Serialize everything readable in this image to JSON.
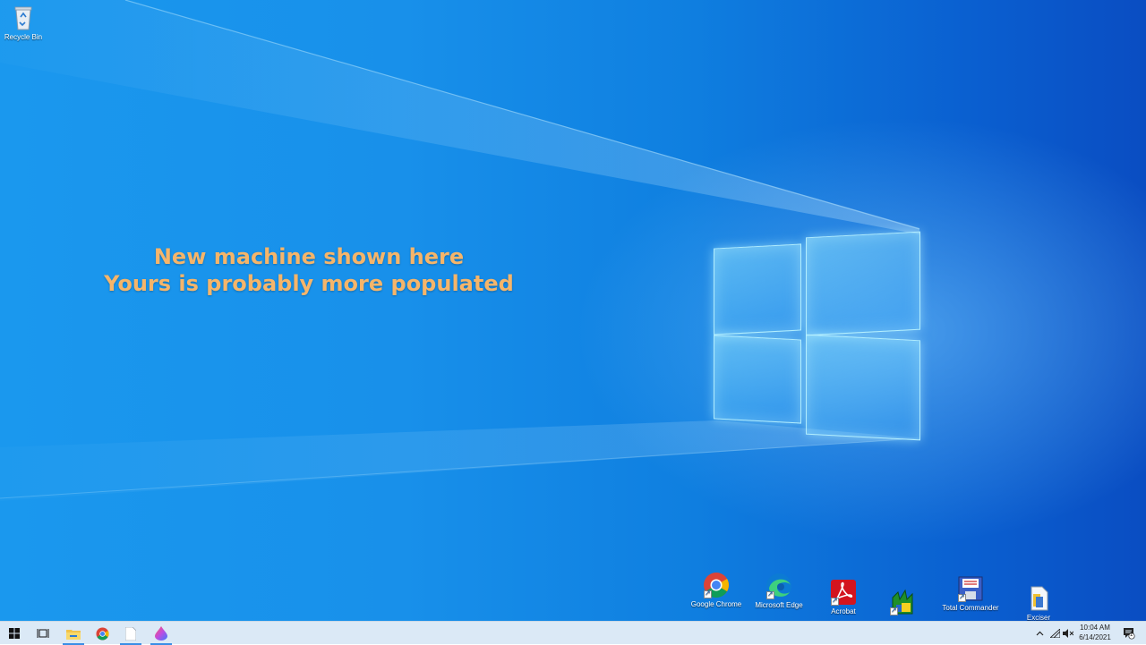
{
  "desktop": {
    "overlay_text": {
      "line1": "New machine shown here",
      "line2": "Yours is probably more populated"
    },
    "icons": [
      {
        "name": "recycle-bin",
        "label": "Recycle Bin"
      },
      {
        "name": "google-chrome",
        "label": "Google Chrome"
      },
      {
        "name": "microsoft-edge",
        "label": "Microsoft Edge"
      },
      {
        "name": "acrobat",
        "label": "Acrobat"
      },
      {
        "name": "green-app",
        "label": ""
      },
      {
        "name": "total-commander",
        "label": "Total Commander"
      },
      {
        "name": "exciser",
        "label": "Exciser"
      }
    ]
  },
  "taskbar": {
    "pinned": [
      {
        "icon": "windows-start-icon"
      },
      {
        "icon": "task-view-icon"
      },
      {
        "icon": "file-explorer-icon"
      },
      {
        "icon": "chrome-icon"
      },
      {
        "icon": "blank-document-icon"
      },
      {
        "icon": "app-drop-icon"
      }
    ],
    "tray": {
      "chevron": "^",
      "time": "10:04 AM",
      "date": "6/14/2021",
      "notification_count": "1"
    }
  },
  "colors": {
    "overlay_text": "#f5b56a",
    "taskbar_bg": "#dbe9f6",
    "accent": "#3a8ee6"
  }
}
